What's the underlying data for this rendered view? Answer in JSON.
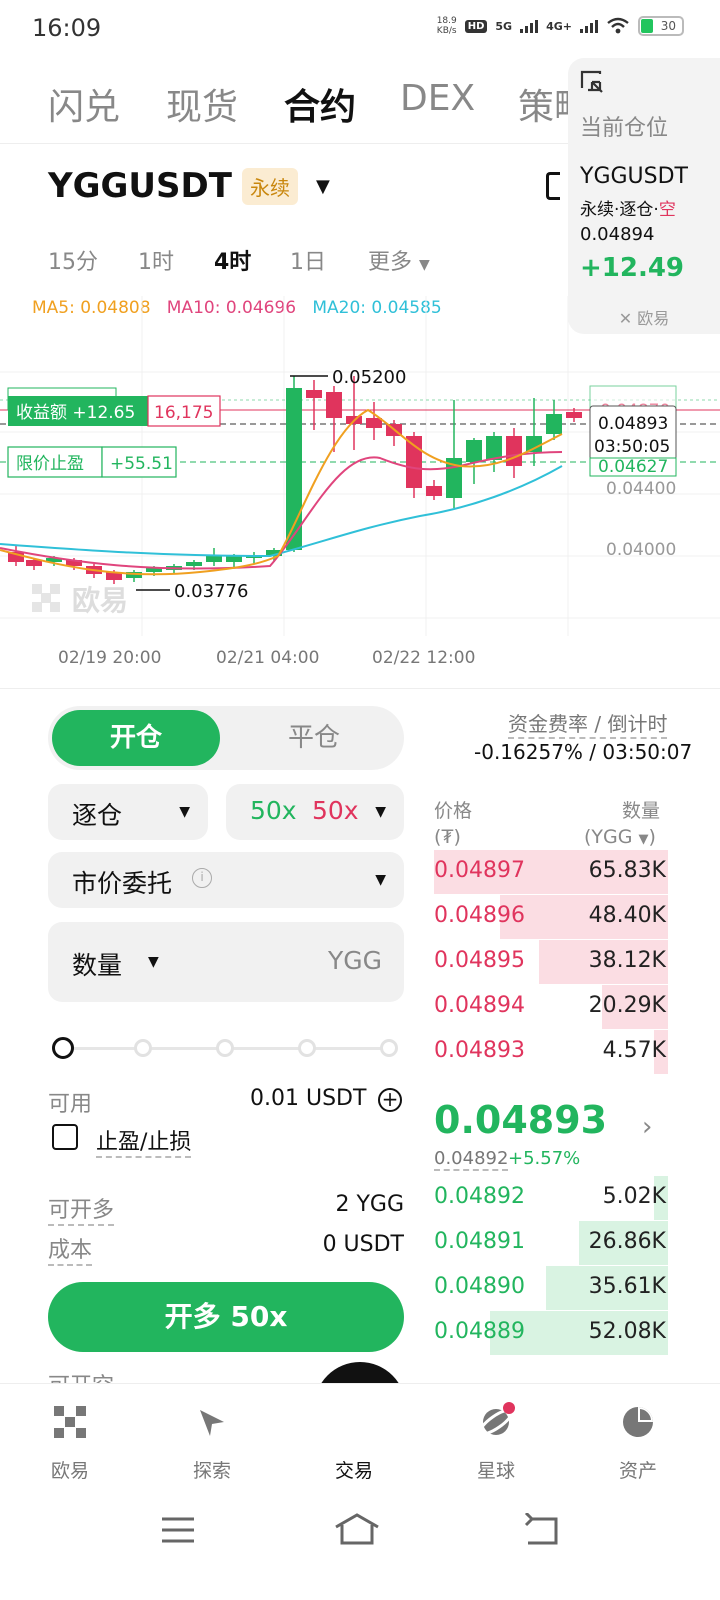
{
  "status": {
    "time": "16:09",
    "net_speed": "18.9",
    "net_unit": "KB/s",
    "hd": "HD",
    "net_5g": "5G",
    "net_4g": "4G+",
    "battery": "30"
  },
  "top_tabs": [
    "闪兑",
    "现货",
    "合约",
    "DEX",
    "策略"
  ],
  "position_card": {
    "title": "当前仓位",
    "symbol": "YGGUSDT",
    "sub_prefix": "永续·逐仓·",
    "side": "空",
    "price": "0.04894",
    "pnl": "+12.49",
    "brand": "欧易"
  },
  "instrument": {
    "symbol": "YGGUSDT",
    "tag": "永续"
  },
  "timeframes": [
    "15分",
    "1时",
    "4时",
    "1日",
    "更多"
  ],
  "ma": {
    "ma5": "MA5: 0.04808",
    "ma10": "MA10: 0.04696",
    "ma20": "MA20: 0.04585"
  },
  "chart_labels": {
    "high": "0.05200",
    "low": "0.03776",
    "profit_label": "收益额 +12.65",
    "profit_qty": "16,175",
    "tp_label": "限价止盈",
    "tp_value": "+55.51",
    "current_price": "0.04893",
    "countdown": "03:50:05",
    "y_top": "0.04870",
    "y_tp": "0.04627",
    "y_4400": "0.04400",
    "y_4000": "0.04000",
    "watermark": "欧易"
  },
  "xaxis": [
    "02/19 20:00",
    "02/21 04:00",
    "02/22 12:00"
  ],
  "chart_data": {
    "type": "candlestick",
    "series": [
      {
        "name": "MA5",
        "values": []
      },
      {
        "name": "MA10",
        "values": []
      },
      {
        "name": "MA20",
        "values": []
      }
    ],
    "x": [
      "02/19 20:00",
      "02/21 04:00",
      "02/22 12:00"
    ],
    "high": 0.052,
    "low": 0.03776,
    "last": 0.04893,
    "ylim": [
      0.036,
      0.053
    ]
  },
  "form": {
    "open_label": "开仓",
    "close_label": "平仓",
    "margin_mode": "逐仓",
    "lev_long": "50x",
    "lev_short": "50x",
    "order_type": "市价委托",
    "qty_label": "数量",
    "qty_unit": "YGG",
    "available_label": "可用",
    "available_value": "0.01 USDT",
    "tpsl_label": "止盈/止损",
    "max_open_label": "可开多",
    "max_open_value": "2 YGG",
    "cost_label": "成本",
    "cost_value": "0 USDT",
    "cta_label": "开多 50x",
    "cut_label": "可开空"
  },
  "funding": {
    "label": "资金费率 / 倒计时",
    "value": "-0.16257% / 03:50:07"
  },
  "orderbook": {
    "price_header": "价格",
    "price_unit": "(₮)",
    "qty_header": "数量",
    "qty_unit": "(YGG",
    "asks": [
      {
        "price": "0.04897",
        "qty": "65.83K",
        "depth": 1.0
      },
      {
        "price": "0.04896",
        "qty": "48.40K",
        "depth": 0.72
      },
      {
        "price": "0.04895",
        "qty": "38.12K",
        "depth": 0.55
      },
      {
        "price": "0.04894",
        "qty": "20.29K",
        "depth": 0.28
      },
      {
        "price": "0.04893",
        "qty": "4.57K",
        "depth": 0.06
      }
    ],
    "last_price": "0.04893",
    "mark_price": "0.04892",
    "change": "+5.57%",
    "bids": [
      {
        "price": "0.04892",
        "qty": "5.02K",
        "depth": 0.06
      },
      {
        "price": "0.04891",
        "qty": "26.86K",
        "depth": 0.38
      },
      {
        "price": "0.04890",
        "qty": "35.61K",
        "depth": 0.52
      },
      {
        "price": "0.04889",
        "qty": "52.08K",
        "depth": 0.76
      }
    ]
  },
  "bottom_nav": [
    "欧易",
    "探索",
    "交易",
    "星球",
    "资产"
  ],
  "colors": {
    "green": "#22b55e",
    "red": "#e0345d",
    "ma5": "#f0a020",
    "ma10": "#e0457d",
    "ma20": "#30c0d8"
  }
}
